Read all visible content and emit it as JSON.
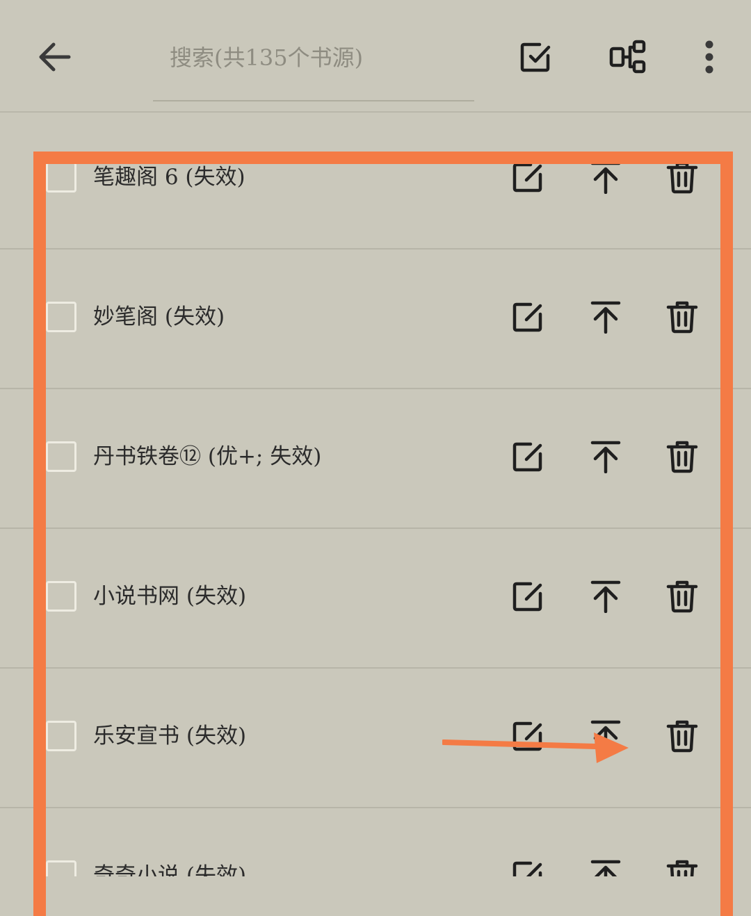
{
  "header": {
    "search_placeholder": "搜索(共135个书源)",
    "icons": {
      "back": "arrow-left-icon",
      "select_all": "checkbox-edit-icon",
      "group": "group-icon",
      "more": "more-vert-icon"
    }
  },
  "sources": [
    {
      "name": "笔趣阁 6 (失效)"
    },
    {
      "name": "妙笔阁 (失效)"
    },
    {
      "name": "丹书铁卷⑫ (优+; 失效)"
    },
    {
      "name": "小说书网 (失效)"
    },
    {
      "name": "乐安宣书 (失效)"
    },
    {
      "name": "奇奇小说 (失效)"
    }
  ],
  "row_icons": {
    "edit": "edit-icon",
    "move_top": "move-to-top-icon",
    "delete": "trash-icon"
  },
  "colors": {
    "background": "#CAC8BB",
    "annotation": "#F47B45",
    "icon": "#1F1F1F",
    "placeholder": "#8E8C81"
  }
}
